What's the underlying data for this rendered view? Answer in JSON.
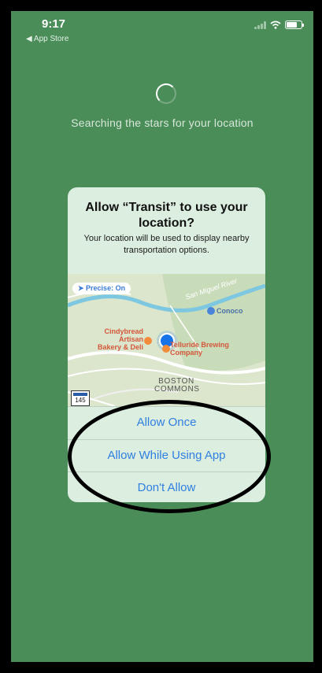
{
  "status_bar": {
    "time": "9:17",
    "back_label": "◀ App Store"
  },
  "loading": {
    "message": "Searching the stars for your location"
  },
  "dialog": {
    "title": "Allow “Transit” to use your location?",
    "message": "Your location will be used to display nearby transportation options.",
    "map": {
      "precise_badge": "➤ Precise: On",
      "labels": {
        "conoco": "Conoco",
        "cindybread": "Cindybread Artisan Bakery & Deli",
        "telluride": "Telluride Brewing Company",
        "river": "San Miguel River",
        "boston": "BOSTON COMMONS",
        "route": "145"
      }
    },
    "buttons": {
      "allow_once": "Allow Once",
      "allow_while_using": "Allow While Using App",
      "dont_allow": "Don't Allow"
    }
  },
  "colors": {
    "background": "#4a8d58",
    "dialog": "#dceee0",
    "action_blue": "#2f7fe0",
    "location_dot": "#1673ea"
  }
}
